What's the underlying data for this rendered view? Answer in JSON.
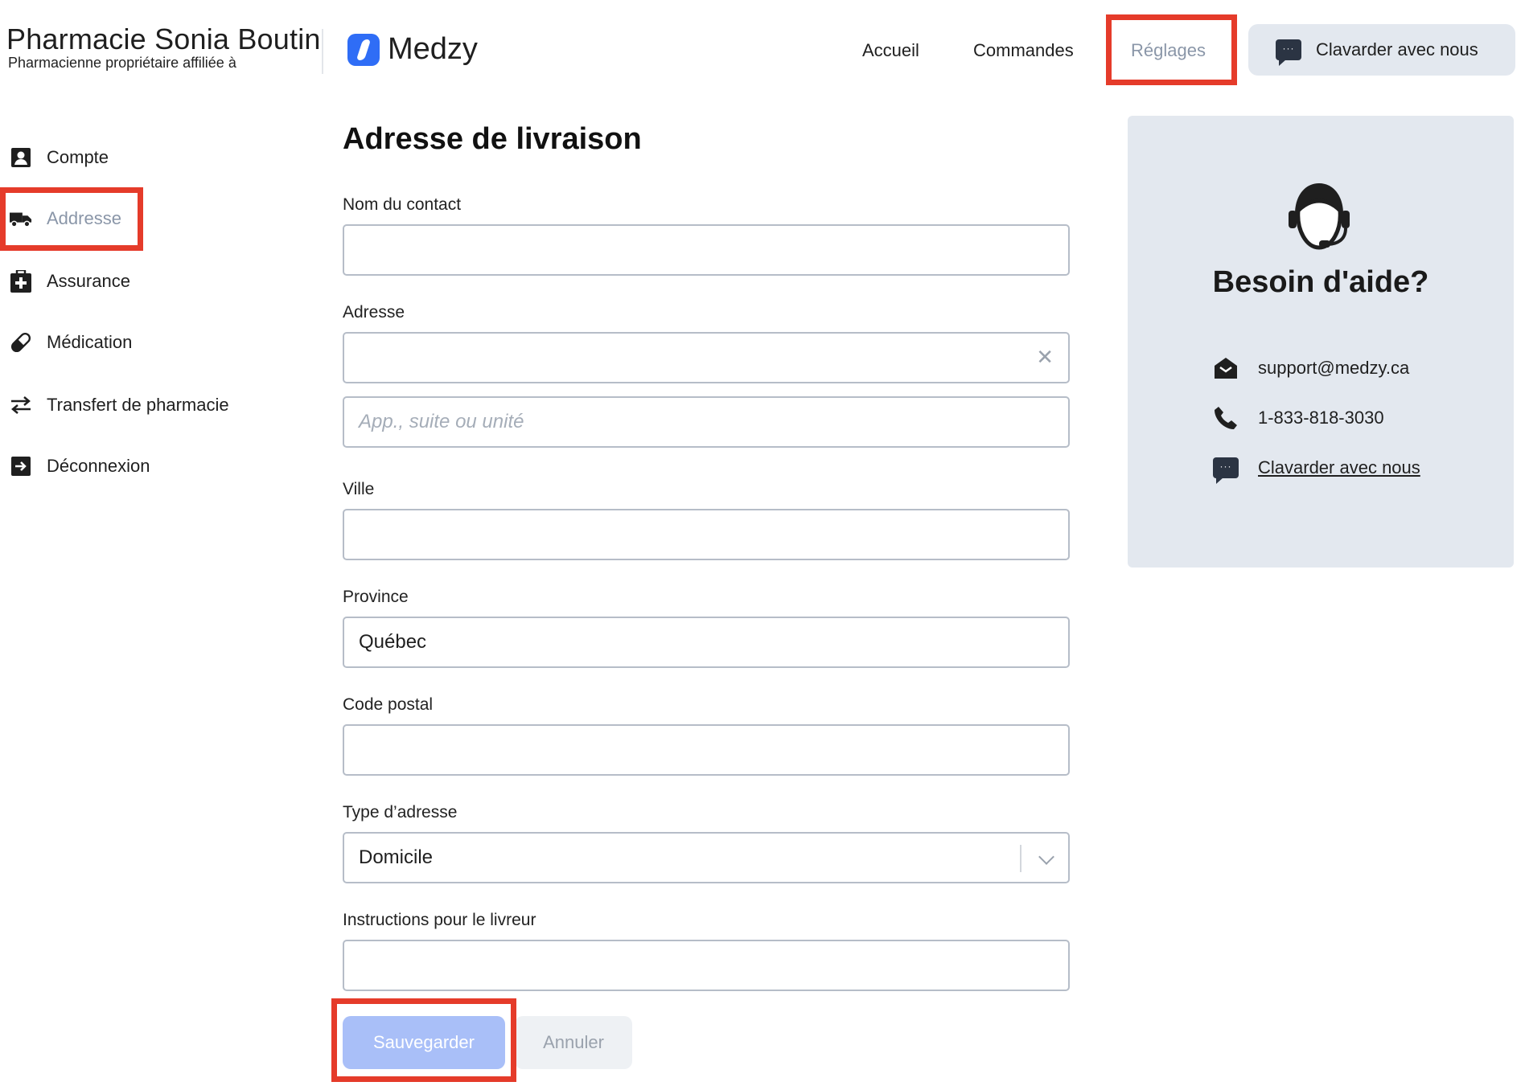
{
  "header": {
    "pharmacy_name": "Pharmacie Sonia Boutin",
    "pharmacy_subtitle": "Pharmacienne propriétaire affiliée à",
    "app_name": "Medzy",
    "nav": {
      "accueil": "Accueil",
      "commandes": "Commandes",
      "reglages": "Réglages"
    },
    "chat_button": "Clavarder avec nous"
  },
  "sidebar": {
    "items": [
      {
        "label": "Compte",
        "icon": "user-card-icon"
      },
      {
        "label": "Addresse",
        "icon": "truck-icon",
        "active": true
      },
      {
        "label": "Assurance",
        "icon": "medical-bag-icon"
      },
      {
        "label": "Médication",
        "icon": "pill-icon"
      },
      {
        "label": "Transfert de pharmacie",
        "icon": "transfer-arrows-icon"
      },
      {
        "label": "Déconnexion",
        "icon": "logout-icon"
      }
    ]
  },
  "form": {
    "title": "Adresse de livraison",
    "contact_label": "Nom du contact",
    "contact_value": "",
    "address_label": "Adresse",
    "address_value": "",
    "unit_placeholder": "App., suite ou unité",
    "city_label": "Ville",
    "city_value": "",
    "province_label": "Province",
    "province_value": "Québec",
    "postal_label": "Code postal",
    "postal_value": "",
    "type_label": "Type d’adresse",
    "type_value": "Domicile",
    "instructions_label": "Instructions pour le livreur",
    "instructions_value": "",
    "save_label": "Sauvegarder",
    "cancel_label": "Annuler"
  },
  "help": {
    "title": "Besoin d'aide?",
    "email": "support@medzy.ca",
    "phone": "1-833-818-3030",
    "chat_link": "Clavarder avec nous"
  },
  "colors": {
    "accent": "#2f6df6",
    "highlight": "#e53b2a",
    "muted": "#8a96a8",
    "panel": "#e3e8ef",
    "save_button": "#a9bff8"
  }
}
